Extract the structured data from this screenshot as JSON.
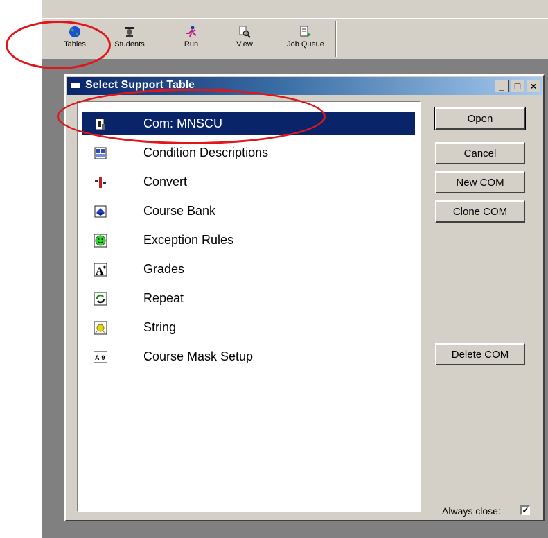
{
  "toolbar": {
    "items": [
      {
        "label": "Tables",
        "icon": "globe-icon"
      },
      {
        "label": "Students",
        "icon": "student-icon"
      },
      {
        "label": "Run",
        "icon": "runner-icon"
      },
      {
        "label": "View",
        "icon": "magnifier-icon"
      },
      {
        "label": "Job Queue",
        "icon": "document-queue-icon"
      }
    ]
  },
  "dialog": {
    "title": "Select Support Table",
    "controls": {
      "minimize": "_",
      "maximize": "□",
      "close": "×"
    },
    "list_items": [
      {
        "label": "Com:  MNSCU",
        "icon": "com-table-icon",
        "selected": true
      },
      {
        "label": "Condition Descriptions",
        "icon": "condition-icon",
        "selected": false
      },
      {
        "label": "Convert",
        "icon": "convert-icon",
        "selected": false
      },
      {
        "label": "Course Bank",
        "icon": "course-bank-icon",
        "selected": false
      },
      {
        "label": "Exception Rules",
        "icon": "smiley-icon",
        "selected": false
      },
      {
        "label": "Grades",
        "icon": "grade-a-plus-icon",
        "selected": false
      },
      {
        "label": "Repeat",
        "icon": "repeat-icon",
        "selected": false
      },
      {
        "label": "String",
        "icon": "string-ball-icon",
        "selected": false
      },
      {
        "label": "Course Mask Setup",
        "icon": "a-9-mask-icon",
        "selected": false
      }
    ],
    "buttons": {
      "open": "Open",
      "cancel": "Cancel",
      "new_com": "New COM",
      "clone_com": "Clone COM",
      "delete_com": "Delete COM"
    },
    "always_close_label": "Always close:",
    "always_close_checked": "✓"
  },
  "colors": {
    "selection": "#0a246a",
    "annotation": "#e0161b",
    "face": "#d4d0c8"
  }
}
